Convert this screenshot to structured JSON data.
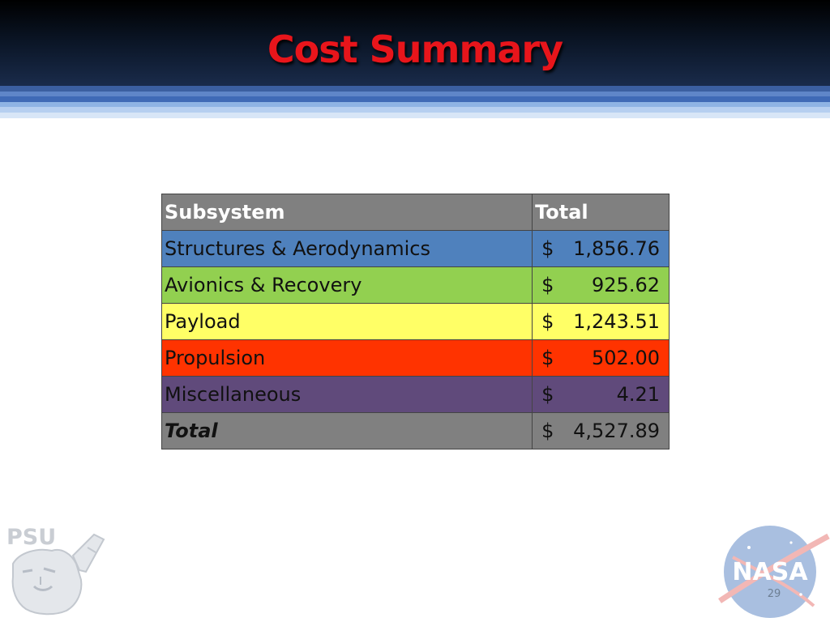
{
  "slide": {
    "title": "Cost Summary",
    "page_number": "29"
  },
  "table": {
    "headers": [
      "Subsystem",
      "Total"
    ],
    "rows": [
      {
        "subsystem": "Structures & Aerodynamics",
        "currency": "$",
        "amount": "1,856.76",
        "color": "#4f81bd"
      },
      {
        "subsystem": "Avionics & Recovery",
        "currency": "$",
        "amount": "925.62",
        "color": "#92d050"
      },
      {
        "subsystem": "Payload",
        "currency": "$",
        "amount": "1,243.51",
        "color": "#ffff66"
      },
      {
        "subsystem": "Propulsion",
        "currency": "$",
        "amount": "502.00",
        "color": "#ff3300"
      },
      {
        "subsystem": "Miscellaneous",
        "currency": "$",
        "amount": "4.21",
        "color": "#604a7b"
      }
    ],
    "total": {
      "label": "Total",
      "currency": "$",
      "amount": "4,527.89",
      "color": "#808080"
    }
  },
  "logos": {
    "left": {
      "icon": "psu-nittany-lion-logo",
      "text": "PSU"
    },
    "right": {
      "icon": "nasa-meatball-logo",
      "text": "NASA"
    }
  }
}
